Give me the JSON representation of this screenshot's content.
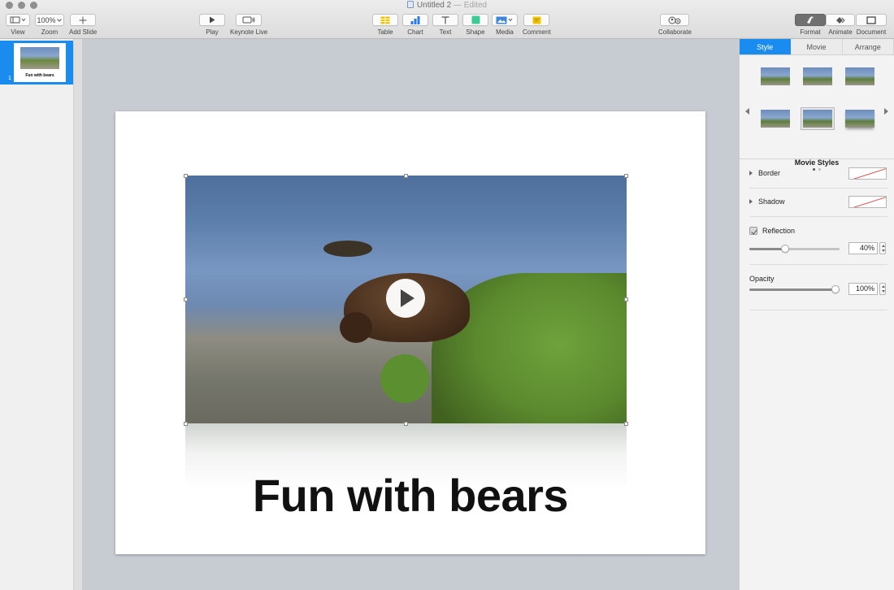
{
  "window": {
    "title": "Untitled 2",
    "status": "— Edited"
  },
  "toolbar": {
    "view": {
      "label": "View"
    },
    "zoom": {
      "label": "Zoom",
      "value": "100%"
    },
    "add_slide": {
      "label": "Add Slide"
    },
    "play": {
      "label": "Play"
    },
    "keynote_live": {
      "label": "Keynote Live"
    },
    "table": {
      "label": "Table"
    },
    "chart": {
      "label": "Chart"
    },
    "text": {
      "label": "Text"
    },
    "shape": {
      "label": "Shape"
    },
    "media": {
      "label": "Media"
    },
    "comment": {
      "label": "Comment"
    },
    "collaborate": {
      "label": "Collaborate"
    },
    "format": {
      "label": "Format"
    },
    "animate": {
      "label": "Animate"
    },
    "document": {
      "label": "Document"
    }
  },
  "navigator": {
    "slides": [
      {
        "number": "1",
        "title": "Fun with bears",
        "selected": true
      }
    ]
  },
  "slide": {
    "title": "Fun with bears"
  },
  "inspector": {
    "tabs": [
      {
        "label": "Style",
        "active": true
      },
      {
        "label": "Movie",
        "active": false
      },
      {
        "label": "Arrange",
        "active": false
      }
    ],
    "movie_styles_label": "Movie Styles",
    "border_label": "Border",
    "shadow_label": "Shadow",
    "reflection": {
      "label": "Reflection",
      "checked": true,
      "value": "40%",
      "level": 0.4
    },
    "opacity": {
      "label": "Opacity",
      "value": "100%",
      "level": 1.0
    }
  },
  "colors": {
    "accent": "#1a8cf0"
  }
}
